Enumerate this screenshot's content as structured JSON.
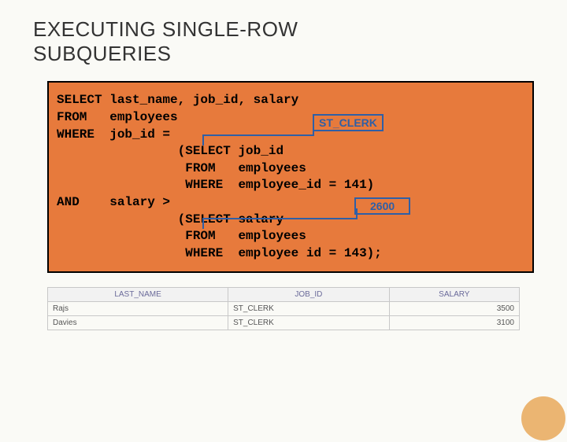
{
  "title_line1": "EXECUTING SINGLE-ROW",
  "title_line2": "SUBQUERIES",
  "code": {
    "l1": "SELECT last_name, job_id, salary",
    "l2": "FROM   employees",
    "l3": "WHERE  job_id =",
    "l4": "                (SELECT job_id",
    "l5": "                 FROM   employees",
    "l6": "                 WHERE  employee_id = 141)",
    "l7": "AND    salary >",
    "l8": "                (SELECT salary",
    "l9": "                 FROM   employees",
    "l10": "                 WHERE  employee id = 143);"
  },
  "annot": {
    "stclerk": "ST_CLERK",
    "v2600": "2600"
  },
  "table": {
    "headers": [
      "LAST_NAME",
      "JOB_ID",
      "SALARY"
    ],
    "rows": [
      [
        "Rajs",
        "ST_CLERK",
        "3500"
      ],
      [
        "Davies",
        "ST_CLERK",
        "3100"
      ]
    ]
  }
}
